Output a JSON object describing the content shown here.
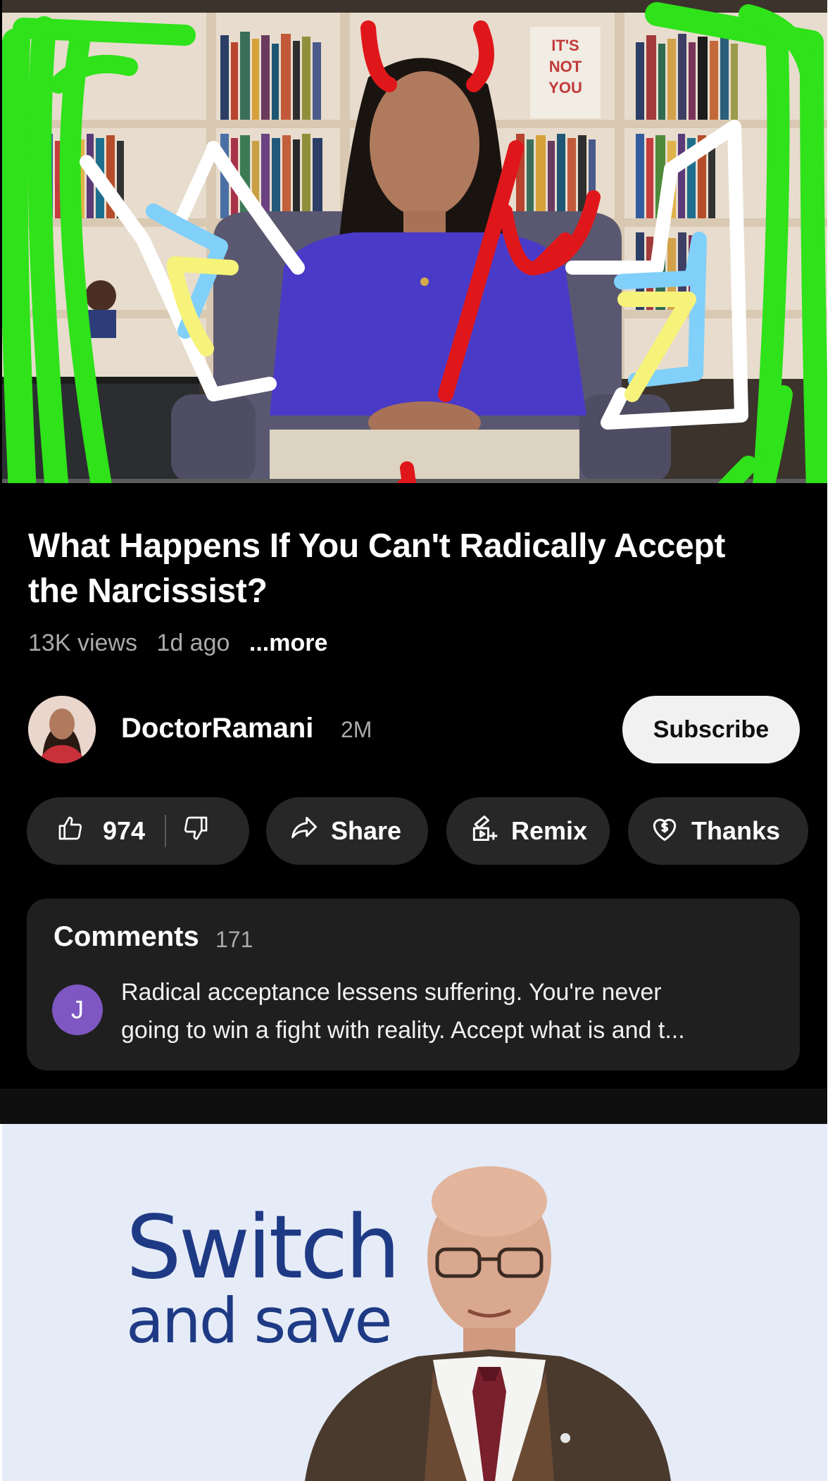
{
  "video": {
    "title": "What Happens If You Can't Radically Accept the Narcissist?",
    "views": "13K views",
    "age": "1d ago",
    "more_label": "...more",
    "thumbnail_text": "IT'S NOT YOU"
  },
  "channel": {
    "name": "DoctorRamani",
    "subscribers": "2M",
    "subscribe_label": "Subscribe"
  },
  "actions": {
    "like_count": "974",
    "share_label": "Share",
    "remix_label": "Remix",
    "thanks_label": "Thanks",
    "icons": [
      "thumbs-up-icon",
      "thumbs-down-icon",
      "share-arrow-icon",
      "remix-icon",
      "thanks-heart-dollar-icon"
    ]
  },
  "comments": {
    "heading": "Comments",
    "count": "171",
    "top_comment": {
      "avatar_initial": "J",
      "avatar_color": "#7e57c2",
      "line1": "Radical acceptance lessens suffering. You're never",
      "line2": "going to win a fight with reality. Accept what is and t..."
    }
  },
  "ad": {
    "headline": "Switch",
    "subline": "and save",
    "brand_color": "#1f3a85",
    "background": "#e6ecf7"
  },
  "colors": {
    "app_bg": "#000000",
    "pill_bg": "#272727",
    "card_bg": "#1f1f1f",
    "scribble_green": "#2fe21a",
    "scribble_red": "#e0171a",
    "scribble_white": "#ffffff",
    "scribble_blue": "#80d0fa",
    "scribble_yellow": "#f7f37a"
  }
}
